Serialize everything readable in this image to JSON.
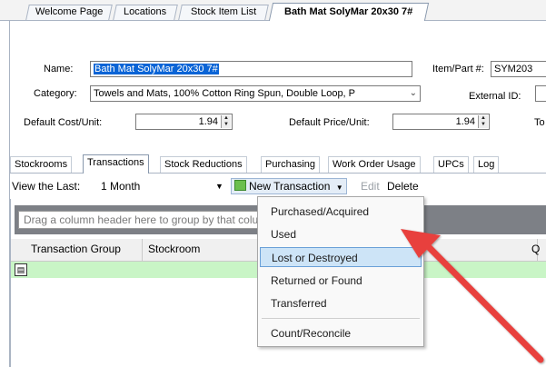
{
  "doc_tabs": [
    {
      "label": "Welcome Page"
    },
    {
      "label": "Locations"
    },
    {
      "label": "Stock Item List"
    },
    {
      "label": "Bath Mat SolyMar 20x30 7#"
    }
  ],
  "form": {
    "name_label": "Name:",
    "name_value": "Bath Mat SolyMar 20x30 7#",
    "item_part_label": "Item/Part #:",
    "item_part_value": "SYM203",
    "category_label": "Category:",
    "category_value": "Towels and Mats, 100% Cotton Ring Spun, Double Loop, P",
    "external_id_label": "External ID:",
    "default_cost_label": "Default Cost/Unit:",
    "default_cost_value": "1.94",
    "default_price_label": "Default Price/Unit:",
    "default_price_value": "1.94",
    "to_label": "To"
  },
  "sub_tabs": [
    "Stockrooms",
    "Transactions",
    "Stock Reductions",
    "Purchasing",
    "Work Order Usage",
    "UPCs",
    "Log"
  ],
  "toolbar": {
    "view_last_label": "View the Last:",
    "view_last_value": "1 Month",
    "new_transaction": "New Transaction",
    "edit": "Edit",
    "delete": "Delete"
  },
  "grid": {
    "group_hint": "Drag a column header here to group by that column",
    "columns": [
      "Transaction Group",
      "Stockroom",
      "Q"
    ]
  },
  "menu": {
    "items": [
      "Purchased/Acquired",
      "Used",
      "Lost or Destroyed",
      "Returned or Found",
      "Transferred",
      "Count/Reconcile"
    ]
  },
  "colors": {
    "accent": "#0a64d6",
    "menu_highlight": "#cde4f7",
    "arrow": "#e8413c",
    "new_row": "#c9f5c6"
  }
}
